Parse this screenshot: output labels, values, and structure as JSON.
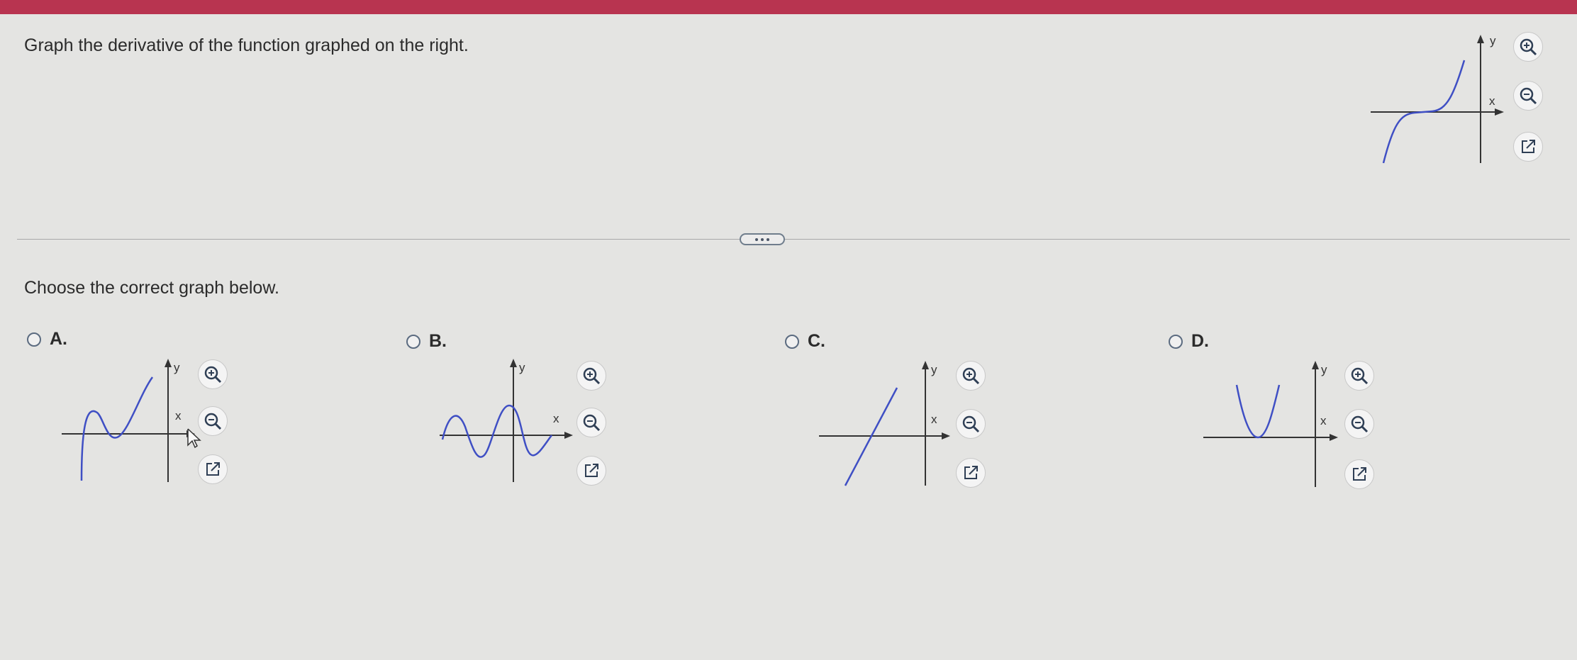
{
  "question": {
    "prompt": "Graph the derivative of the function graphed on the right."
  },
  "main": {
    "instruction": "Choose the correct graph below.",
    "more_button_label": "..."
  },
  "axis_labels": {
    "x": "x",
    "y": "y"
  },
  "options": [
    {
      "letter": "A.",
      "selected": false,
      "curve": "sine-like"
    },
    {
      "letter": "B.",
      "selected": false,
      "curve": "wave"
    },
    {
      "letter": "C.",
      "selected": false,
      "curve": "line"
    },
    {
      "letter": "D.",
      "selected": false,
      "curve": "parabola"
    }
  ],
  "icons": {
    "zoom_in": "zoom-in-icon",
    "zoom_out": "zoom-out-icon",
    "open": "open-external-icon"
  },
  "colors": {
    "topbar": "#b83450",
    "curve": "#3f4fc4",
    "axis": "#333333",
    "tool": "#2f3f55"
  }
}
